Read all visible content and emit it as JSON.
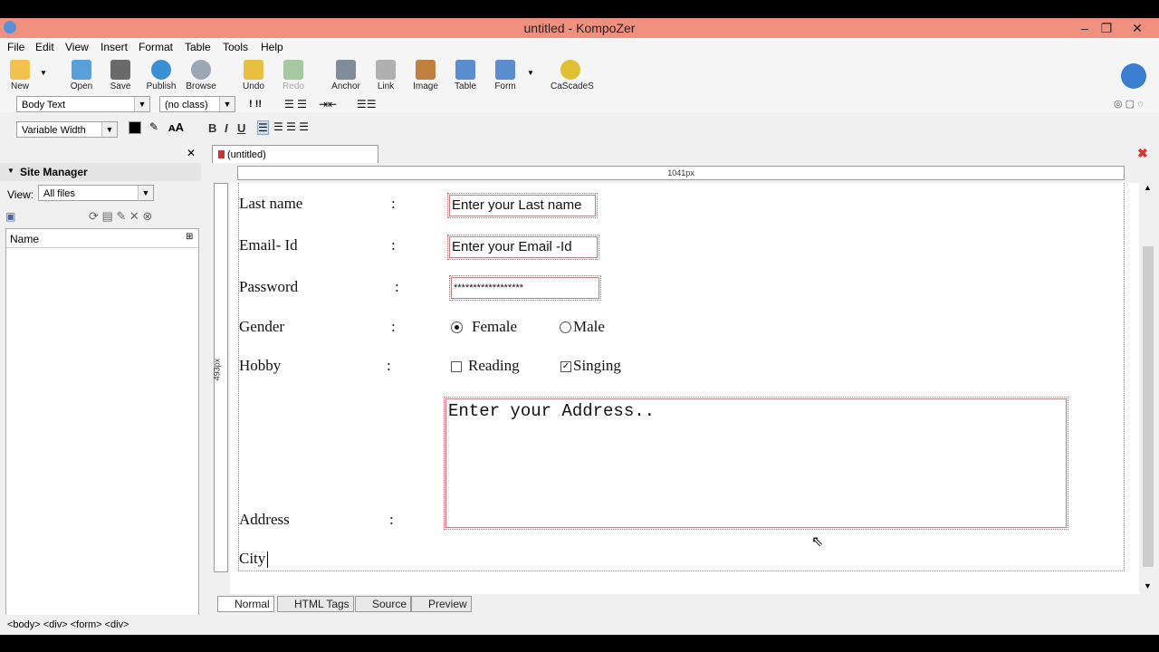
{
  "window": {
    "title": "untitled - KompoZer",
    "minimize": "–",
    "restore": "❐",
    "close": "✕"
  },
  "menu": [
    "File",
    "Edit",
    "View",
    "Insert",
    "Format",
    "Table",
    "Tools",
    "Help"
  ],
  "toolbar": {
    "items": [
      {
        "label": "New",
        "color": "#f2c14e"
      },
      {
        "label": "Open",
        "color": "#5aa0d8"
      },
      {
        "label": "Save",
        "color": "#6a6a6a"
      },
      {
        "label": "Publish",
        "color": "#3a8fd0"
      },
      {
        "label": "Browse",
        "color": "#9aa7b5"
      },
      {
        "label": "Undo",
        "color": "#e8c040"
      },
      {
        "label": "Redo",
        "color": "#a6c8a0"
      },
      {
        "label": "Anchor",
        "color": "#7f8c99"
      },
      {
        "label": "Link",
        "color": "#b0b0b0"
      },
      {
        "label": "Image",
        "color": "#c08040"
      },
      {
        "label": "Table",
        "color": "#5a8ed0"
      },
      {
        "label": "Form",
        "color": "#5a8ed0"
      },
      {
        "label": "CaScadeS",
        "color": "#e0c030"
      }
    ]
  },
  "format1": {
    "paragraph": "Body Text",
    "class": "(no class)"
  },
  "format2": {
    "font": "Variable Width",
    "bold": "B",
    "italic": "I",
    "underline": "U"
  },
  "sidebar": {
    "title": "Site Manager",
    "view_label": "View:",
    "view_value": "All files",
    "col_name": "Name",
    "close": "✕"
  },
  "editor": {
    "tab": "(untitled)",
    "ruler": "1041px",
    "vruler": "493px",
    "rows": [
      {
        "label": "Last name",
        "colon": ":"
      },
      {
        "label": "Email- Id",
        "colon": ":"
      },
      {
        "label": "Password",
        "colon": ":"
      },
      {
        "label": "Gender",
        "colon": ":"
      },
      {
        "label": "Hobby",
        "colon": ":"
      },
      {
        "label": "Address",
        "colon": ":"
      },
      {
        "label": "City",
        "colon": ""
      }
    ],
    "lastname_value": "Enter your Last name",
    "email_value": "Enter your Email -Id",
    "password_value": "******************",
    "gender": {
      "female": "Female",
      "male": "Male"
    },
    "hobby": {
      "reading": "Reading",
      "singing": "Singing",
      "check": "✓"
    },
    "address_value": "Enter your Address.."
  },
  "bottom_tabs": [
    "Normal",
    "HTML Tags",
    "Source",
    "Preview"
  ],
  "status": "<body> <div> <form> <div>"
}
